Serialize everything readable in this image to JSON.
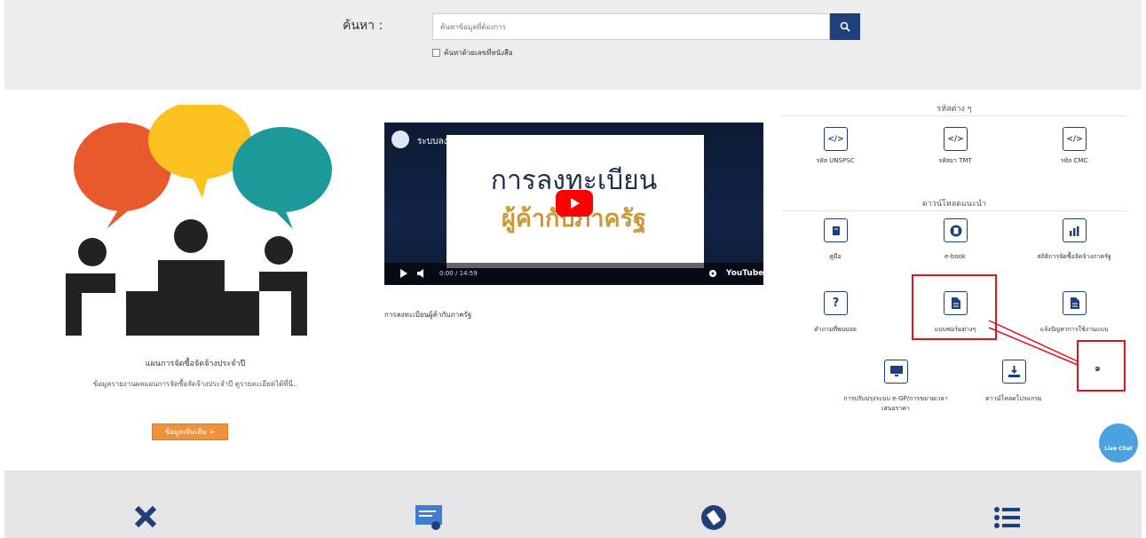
{
  "search": {
    "label": "ค้นหา :",
    "placeholder": "ค้นหาข้อมูลที่ต้องการ",
    "checkbox_label": "ค้นหาด้วยเลขที่หนังสือ",
    "button_icon": "search-icon"
  },
  "plan": {
    "title": "แผนการจัดซื้อจัดจ้างประจำปี",
    "description": "ข้อมูลรายงานผลแผนการจัดซื้อจัดจ้างประจำปี ดูรายละเอียดได้ที่นี่..",
    "more_button": "ข้อมูลเพิ่มเติม >"
  },
  "video": {
    "title": "ระบบลงทะเบียนผู้ค้ากับภาครัฐ",
    "heading_line1": "การลงทะเบียน",
    "heading_line2": "ผู้ค้ากับภาครัฐ",
    "time": "0:00 / 14:59",
    "brand": "YouTube",
    "caption": "การลงทะเบียนผู้ค้ากับภาครัฐ"
  },
  "codes": {
    "heading": "รหัสต่าง ๆ",
    "items": [
      {
        "label": "รหัส UNSPSC",
        "icon": "code-icon"
      },
      {
        "label": "รหัสยา TMT",
        "icon": "code-icon"
      },
      {
        "label": "รหัส CMC",
        "icon": "code-icon"
      }
    ]
  },
  "downloads": {
    "heading": "ดาวน์โหลดแนะนำ",
    "items": [
      {
        "label": "คู่มือ",
        "icon": "book-icon"
      },
      {
        "label": "e-book",
        "icon": "ebook-icon"
      },
      {
        "label": "สถิติการจัดซื้อจัดจ้างภาครัฐ",
        "icon": "chart-icon"
      },
      {
        "label": "คำถามที่พบบ่อย",
        "icon": "question-icon"
      },
      {
        "label": "แบบฟอร์มต่างๆ",
        "icon": "document-icon"
      },
      {
        "label": "แจ้งปัญหาการใช้งานแบบ",
        "icon": "document-icon"
      },
      {
        "label": "การปรับปรุงระบบ e-GP/การขยายเวลาเสนอราคา",
        "icon": "monitor-icon"
      },
      {
        "label": "ดาวน์โหลดโปรแกรม",
        "icon": "download-icon"
      }
    ]
  },
  "annotation": {
    "number": "๑",
    "color": "#e1131d"
  },
  "live_chat": {
    "label": "Live Chat"
  },
  "colors": {
    "navy": "#1f3f7a",
    "orange": "#f0923a",
    "band": "#ededed",
    "red": "#e1131d"
  }
}
